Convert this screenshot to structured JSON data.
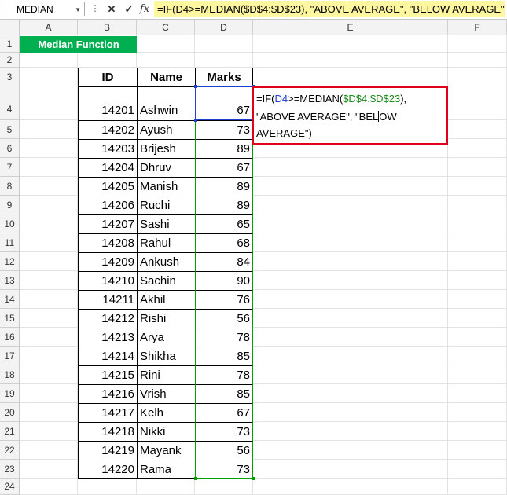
{
  "name_box": {
    "value": "MEDIAN",
    "arrow": "▼"
  },
  "formula_bar": {
    "cancel_label": "✕",
    "enter_label": "✓",
    "fx_label": "fx",
    "formula": "=IF(D4>=MEDIAN($D$4:$D$23), \"ABOVE AVERAGE\", \"BELOW AVERAGE\")",
    "highlight_color": "#fff6a0"
  },
  "columns": [
    "A",
    "B",
    "C",
    "D",
    "E",
    "F"
  ],
  "rows": [
    "1",
    "2",
    "3",
    "4",
    "5",
    "6",
    "7",
    "8",
    "9",
    "10",
    "11",
    "12",
    "13",
    "14",
    "15",
    "16",
    "17",
    "18",
    "19",
    "20",
    "21",
    "22",
    "23",
    "24"
  ],
  "title_cell": {
    "text": "Median Function",
    "color": "#00b050"
  },
  "table": {
    "headers": {
      "id": "ID",
      "name": "Name",
      "marks": "Marks"
    },
    "records": [
      {
        "id": "14201",
        "name": "Ashwin",
        "marks": "67"
      },
      {
        "id": "14202",
        "name": "Ayush",
        "marks": "73"
      },
      {
        "id": "14203",
        "name": "Brijesh",
        "marks": "89"
      },
      {
        "id": "14204",
        "name": "Dhruv",
        "marks": "67"
      },
      {
        "id": "14205",
        "name": "Manish",
        "marks": "89"
      },
      {
        "id": "14206",
        "name": "Ruchi",
        "marks": "89"
      },
      {
        "id": "14207",
        "name": "Sashi",
        "marks": "65"
      },
      {
        "id": "14208",
        "name": "Rahul",
        "marks": "68"
      },
      {
        "id": "14209",
        "name": "Ankush",
        "marks": "84"
      },
      {
        "id": "14210",
        "name": "Sachin",
        "marks": "90"
      },
      {
        "id": "14211",
        "name": "Akhil",
        "marks": "76"
      },
      {
        "id": "14212",
        "name": "Rishi",
        "marks": "56"
      },
      {
        "id": "14213",
        "name": "Arya",
        "marks": "78"
      },
      {
        "id": "14214",
        "name": "Shikha",
        "marks": "85"
      },
      {
        "id": "14215",
        "name": "Rini",
        "marks": "78"
      },
      {
        "id": "14216",
        "name": "Vrish",
        "marks": "85"
      },
      {
        "id": "14217",
        "name": "Kelh",
        "marks": "67"
      },
      {
        "id": "14218",
        "name": "Nikki",
        "marks": "73"
      },
      {
        "id": "14219",
        "name": "Mayank",
        "marks": "56"
      },
      {
        "id": "14220",
        "name": "Rama",
        "marks": "73"
      }
    ]
  },
  "edit_cell": {
    "line1_a": "=IF(",
    "line1_ref": "D4",
    "line1_b": ">=MEDIAN(",
    "line1_range": "$D$4:$D$23",
    "line1_c": "),",
    "line2_a": "\"ABOVE AVERAGE\", \"BEL",
    "line2_b": "OW",
    "line3": "AVERAGE\")",
    "border_color": "#e0001b"
  }
}
